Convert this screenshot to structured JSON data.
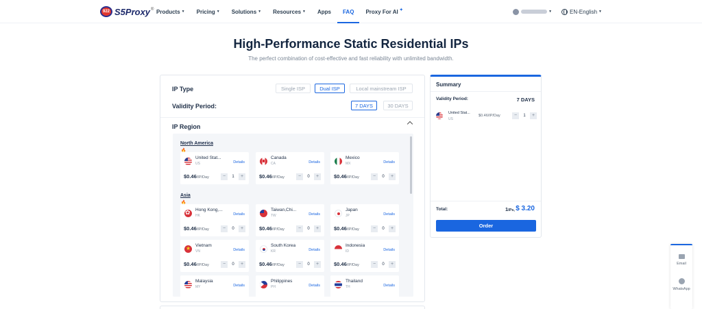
{
  "nav": {
    "logo_badge": "922",
    "logo_text": "S5Proxy",
    "logo_reg": "®",
    "links": [
      {
        "label": "Products",
        "caret": "▼"
      },
      {
        "label": "Pricing",
        "caret": "▼"
      },
      {
        "label": "Solutions",
        "caret": "▼"
      },
      {
        "label": "Resources",
        "caret": "▼"
      },
      {
        "label": "Apps",
        "caret": ""
      },
      {
        "label": "FAQ",
        "caret": ""
      },
      {
        "label": "Proxy For AI",
        "caret": "✦"
      }
    ],
    "active": "Proxy For AI",
    "user_caret": "▼",
    "language": "EN-English",
    "language_caret": "▼"
  },
  "hero": {
    "title": "High-Performance Static Residential IPs",
    "subtitle": "The perfect combination of cost-effective and fast reliability with unlimited bandwidth."
  },
  "config": {
    "ip_type_label": "IP Type",
    "ip_types": [
      "Single ISP",
      "Dual ISP",
      "Local mainstream ISP"
    ],
    "ip_type_selected": "Dual ISP",
    "validity_label": "Validity Period:",
    "validity_options": [
      "7 DAYS",
      "30 DAYS"
    ],
    "validity_selected": "7 DAYS",
    "region_label": "IP Region",
    "fire_icon": "🔥",
    "details_label": "Details",
    "price_unit": "/IP/Day",
    "minus": "−",
    "plus": "+",
    "regions": [
      {
        "name": "North America",
        "countries": [
          {
            "name": "United Stat...",
            "code": "US",
            "price": "$0.46",
            "qty": "1",
            "flag": "f-us"
          },
          {
            "name": "Canada",
            "code": "CA",
            "price": "$0.46",
            "qty": "0",
            "flag": "f-ca"
          },
          {
            "name": "Mexico",
            "code": "MX",
            "price": "$0.46",
            "qty": "0",
            "flag": "f-mx"
          }
        ]
      },
      {
        "name": "Asia",
        "countries": [
          {
            "name": "Hong Kong,...",
            "code": "HK",
            "price": "$0.46",
            "qty": "0",
            "flag": "f-hk"
          },
          {
            "name": "Taiwan,Chi...",
            "code": "TW",
            "price": "$0.46",
            "qty": "0",
            "flag": "f-tw"
          },
          {
            "name": "Japan",
            "code": "JP",
            "price": "$0.46",
            "qty": "0",
            "flag": "f-jp"
          },
          {
            "name": "Vietnam",
            "code": "VN",
            "price": "$0.46",
            "qty": "0",
            "flag": "f-vn"
          },
          {
            "name": "South Korea",
            "code": "KR",
            "price": "$0.46",
            "qty": "0",
            "flag": "f-kr"
          },
          {
            "name": "Indonesia",
            "code": "ID",
            "price": "$0.46",
            "qty": "0",
            "flag": "f-id"
          },
          {
            "name": "Malaysia",
            "code": "MY",
            "price": "",
            "qty": "",
            "flag": "f-my"
          },
          {
            "name": "Philippines",
            "code": "PH",
            "price": "",
            "qty": "",
            "flag": "f-ph"
          },
          {
            "name": "Thailand",
            "code": "TH",
            "price": "",
            "qty": "",
            "flag": "f-th"
          }
        ]
      }
    ]
  },
  "summary": {
    "title": "Summary",
    "validity_label": "Validity Period:",
    "validity_value": "7 DAYS",
    "item": {
      "name": "United Stat...",
      "code": "US",
      "price": "$0.46/IP/Day",
      "qty": "1",
      "flag": "f-us"
    },
    "total_label": "Total:",
    "count": "1",
    "count_unit": "IPs,",
    "amount": "$ 3.20",
    "order_label": "Order"
  },
  "contact": {
    "email_label": "Email",
    "whatsapp_label": "WhatsApp"
  },
  "colors": {
    "primary": "#1a66e0",
    "heading": "#13253f",
    "muted": "#7b8796"
  }
}
